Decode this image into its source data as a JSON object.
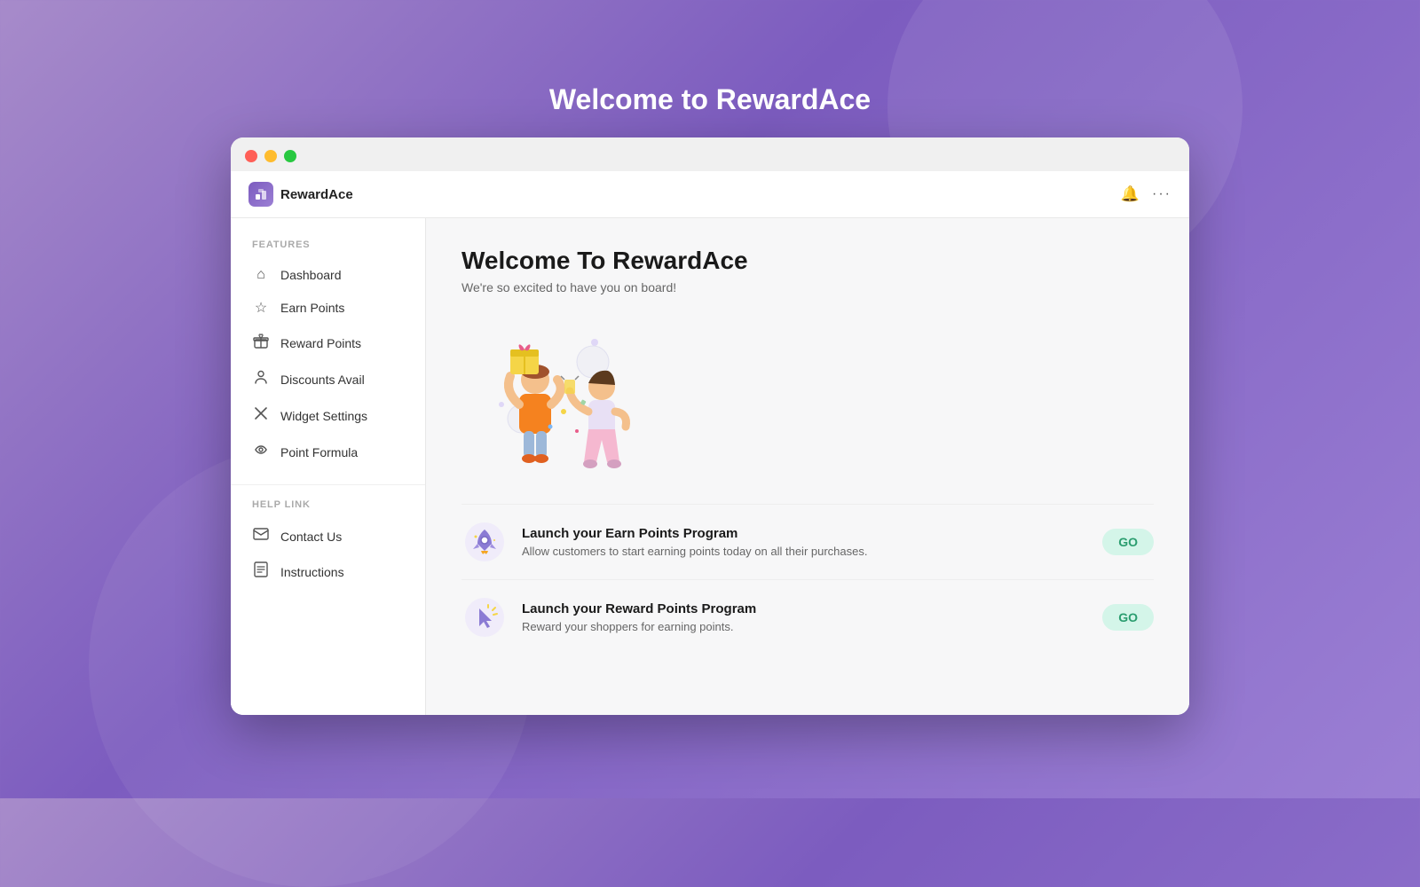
{
  "page": {
    "title": "Welcome to RewardAce"
  },
  "browser": {
    "app_name": "RewardAce"
  },
  "sidebar": {
    "features_label": "FEATURES",
    "help_label": "HELP LINK",
    "items": [
      {
        "id": "dashboard",
        "label": "Dashboard",
        "icon": "🏠"
      },
      {
        "id": "earn-points",
        "label": "Earn Points",
        "icon": "☆"
      },
      {
        "id": "reward-points",
        "label": "Reward Points",
        "icon": "🎁"
      },
      {
        "id": "discounts-avail",
        "label": "Discounts Avail",
        "icon": "👤"
      },
      {
        "id": "widget-settings",
        "label": "Widget Settings",
        "icon": "✕"
      },
      {
        "id": "point-formula",
        "label": "Point Formula",
        "icon": "↺"
      }
    ],
    "help_items": [
      {
        "id": "contact-us",
        "label": "Contact Us",
        "icon": "✉"
      },
      {
        "id": "instructions",
        "label": "Instructions",
        "icon": "📄"
      }
    ]
  },
  "content": {
    "welcome_title": "Welcome To RewardAce",
    "welcome_subtitle": "We're so excited to have you on board!",
    "cta_items": [
      {
        "id": "earn-points-cta",
        "title": "Launch your Earn Points Program",
        "desc": "Allow customers to start earning points today on all their purchases.",
        "button_label": "GO"
      },
      {
        "id": "reward-points-cta",
        "title": "Launch your Reward Points Program",
        "desc": "Reward your shoppers for earning points.",
        "button_label": "GO"
      }
    ]
  }
}
